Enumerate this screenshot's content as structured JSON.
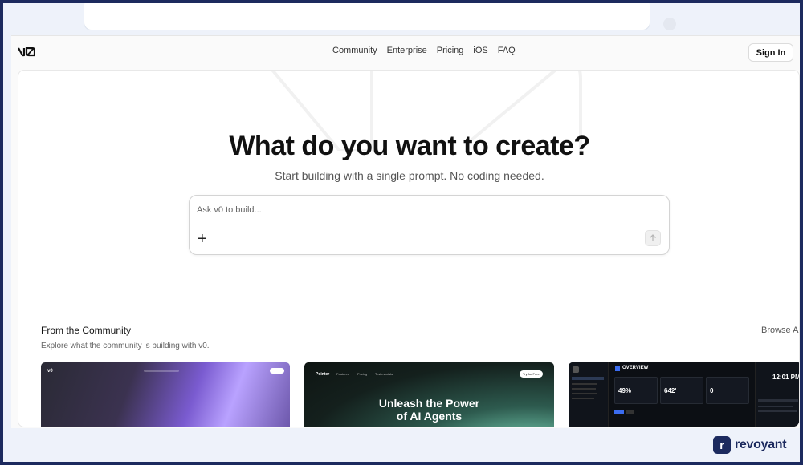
{
  "nav": {
    "logo_text": "v0",
    "links": [
      "Community",
      "Enterprise",
      "Pricing",
      "iOS",
      "FAQ"
    ],
    "sign_in": "Sign In"
  },
  "hero": {
    "title": "What do you want to create?",
    "subtitle": "Start building with a single prompt. No coding needed.",
    "prompt_placeholder": "Ask v0 to build...",
    "plus_glyph": "+"
  },
  "community": {
    "title": "From the Community",
    "subtitle": "Explore what the community is building with v0.",
    "browse_label": "Browse A",
    "thumbs": [
      {
        "name": "purple-landing",
        "logo": "v0"
      },
      {
        "name": "ai-agents",
        "brand": "Pointer",
        "links": [
          "Features",
          "Pricing",
          "Testimonials"
        ],
        "cta": "Try for Free",
        "headline_1": "Unleash the Power",
        "headline_2": "of AI Agents"
      },
      {
        "name": "dashboard",
        "header": "OVERVIEW",
        "stats": [
          "49%",
          "642'",
          "0"
        ],
        "clock": "12:01 PM"
      }
    ]
  },
  "branding": {
    "badge": "r",
    "name": "revoyant"
  },
  "colors": {
    "frame": "#1c2a5e",
    "background": "#eef2fa",
    "accent": "#111111"
  }
}
